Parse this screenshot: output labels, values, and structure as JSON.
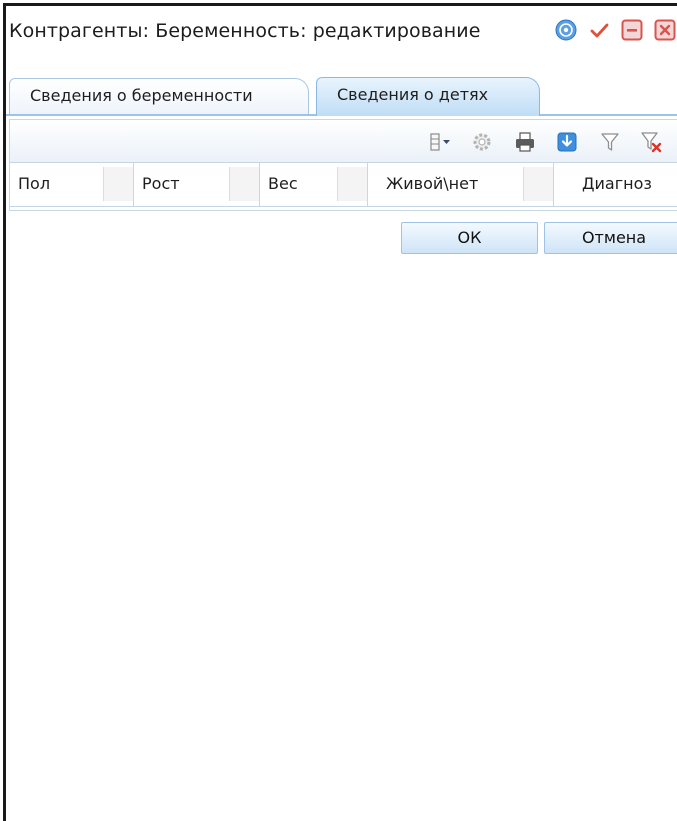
{
  "window": {
    "title": "Контрагенты: Беременность: редактирование",
    "accent_color": "#9cc3e8"
  },
  "title_buttons": [
    {
      "icon": "help-icon",
      "color": "#4a90d9"
    },
    {
      "icon": "check-icon",
      "color": "#e0513a"
    },
    {
      "icon": "minimize-icon",
      "color": "#d9534f"
    },
    {
      "icon": "close-icon",
      "color": "#d9534f"
    }
  ],
  "tabs": [
    {
      "label": "Сведения о беременности",
      "active": false
    },
    {
      "label": "Сведения о детях",
      "active": true
    }
  ],
  "grid": {
    "toolbar": [
      "columns-menu-icon",
      "settings-icon",
      "print-icon",
      "export-icon",
      "filter-icon",
      "clear-filter-icon"
    ],
    "columns": [
      "Пол",
      "Рост",
      "Вес",
      "Живой\\нет",
      "Диагноз"
    ],
    "rows": []
  },
  "buttons": {
    "ok": "ОК",
    "cancel": "Отмена"
  }
}
